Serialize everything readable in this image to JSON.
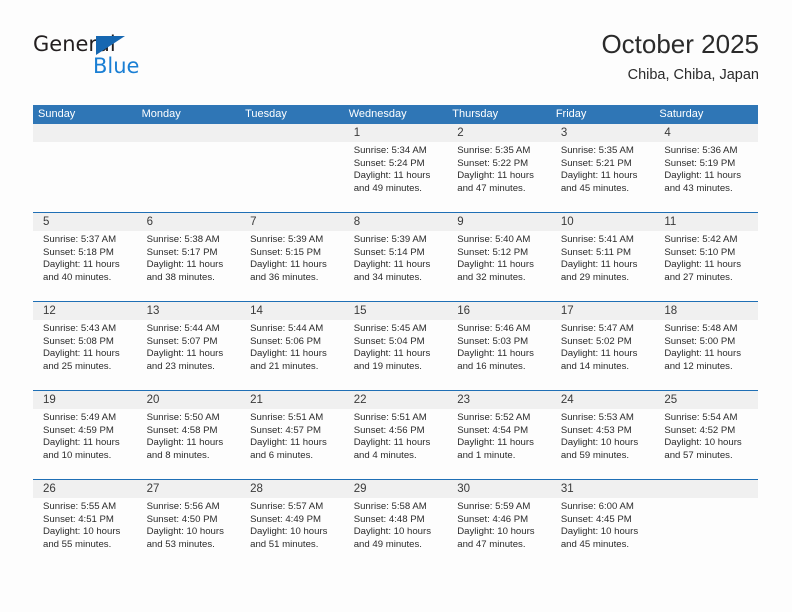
{
  "logo": {
    "word_general": "General",
    "word_blue": "Blue",
    "triangle_color": "#1667b1",
    "blue_text_color": "#1a7fd4"
  },
  "header": {
    "title": "October 2025",
    "subtitle": "Chiba, Chiba, Japan"
  },
  "theme": {
    "header_blue": "#2f76b6",
    "week_separator_blue": "#1f6fb5",
    "day_band_gray": "#f0f0f0",
    "page_background": "#fdfdfd"
  },
  "calendar": {
    "weekday_headers": [
      "Sunday",
      "Monday",
      "Tuesday",
      "Wednesday",
      "Thursday",
      "Friday",
      "Saturday"
    ],
    "weeks": [
      [
        {
          "day": "",
          "sunrise": "",
          "sunset": "",
          "daylight_line1": "",
          "daylight_line2": ""
        },
        {
          "day": "",
          "sunrise": "",
          "sunset": "",
          "daylight_line1": "",
          "daylight_line2": ""
        },
        {
          "day": "",
          "sunrise": "",
          "sunset": "",
          "daylight_line1": "",
          "daylight_line2": ""
        },
        {
          "day": "1",
          "sunrise": "Sunrise: 5:34 AM",
          "sunset": "Sunset: 5:24 PM",
          "daylight_line1": "Daylight: 11 hours",
          "daylight_line2": "and 49 minutes."
        },
        {
          "day": "2",
          "sunrise": "Sunrise: 5:35 AM",
          "sunset": "Sunset: 5:22 PM",
          "daylight_line1": "Daylight: 11 hours",
          "daylight_line2": "and 47 minutes."
        },
        {
          "day": "3",
          "sunrise": "Sunrise: 5:35 AM",
          "sunset": "Sunset: 5:21 PM",
          "daylight_line1": "Daylight: 11 hours",
          "daylight_line2": "and 45 minutes."
        },
        {
          "day": "4",
          "sunrise": "Sunrise: 5:36 AM",
          "sunset": "Sunset: 5:19 PM",
          "daylight_line1": "Daylight: 11 hours",
          "daylight_line2": "and 43 minutes."
        }
      ],
      [
        {
          "day": "5",
          "sunrise": "Sunrise: 5:37 AM",
          "sunset": "Sunset: 5:18 PM",
          "daylight_line1": "Daylight: 11 hours",
          "daylight_line2": "and 40 minutes."
        },
        {
          "day": "6",
          "sunrise": "Sunrise: 5:38 AM",
          "sunset": "Sunset: 5:17 PM",
          "daylight_line1": "Daylight: 11 hours",
          "daylight_line2": "and 38 minutes."
        },
        {
          "day": "7",
          "sunrise": "Sunrise: 5:39 AM",
          "sunset": "Sunset: 5:15 PM",
          "daylight_line1": "Daylight: 11 hours",
          "daylight_line2": "and 36 minutes."
        },
        {
          "day": "8",
          "sunrise": "Sunrise: 5:39 AM",
          "sunset": "Sunset: 5:14 PM",
          "daylight_line1": "Daylight: 11 hours",
          "daylight_line2": "and 34 minutes."
        },
        {
          "day": "9",
          "sunrise": "Sunrise: 5:40 AM",
          "sunset": "Sunset: 5:12 PM",
          "daylight_line1": "Daylight: 11 hours",
          "daylight_line2": "and 32 minutes."
        },
        {
          "day": "10",
          "sunrise": "Sunrise: 5:41 AM",
          "sunset": "Sunset: 5:11 PM",
          "daylight_line1": "Daylight: 11 hours",
          "daylight_line2": "and 29 minutes."
        },
        {
          "day": "11",
          "sunrise": "Sunrise: 5:42 AM",
          "sunset": "Sunset: 5:10 PM",
          "daylight_line1": "Daylight: 11 hours",
          "daylight_line2": "and 27 minutes."
        }
      ],
      [
        {
          "day": "12",
          "sunrise": "Sunrise: 5:43 AM",
          "sunset": "Sunset: 5:08 PM",
          "daylight_line1": "Daylight: 11 hours",
          "daylight_line2": "and 25 minutes."
        },
        {
          "day": "13",
          "sunrise": "Sunrise: 5:44 AM",
          "sunset": "Sunset: 5:07 PM",
          "daylight_line1": "Daylight: 11 hours",
          "daylight_line2": "and 23 minutes."
        },
        {
          "day": "14",
          "sunrise": "Sunrise: 5:44 AM",
          "sunset": "Sunset: 5:06 PM",
          "daylight_line1": "Daylight: 11 hours",
          "daylight_line2": "and 21 minutes."
        },
        {
          "day": "15",
          "sunrise": "Sunrise: 5:45 AM",
          "sunset": "Sunset: 5:04 PM",
          "daylight_line1": "Daylight: 11 hours",
          "daylight_line2": "and 19 minutes."
        },
        {
          "day": "16",
          "sunrise": "Sunrise: 5:46 AM",
          "sunset": "Sunset: 5:03 PM",
          "daylight_line1": "Daylight: 11 hours",
          "daylight_line2": "and 16 minutes."
        },
        {
          "day": "17",
          "sunrise": "Sunrise: 5:47 AM",
          "sunset": "Sunset: 5:02 PM",
          "daylight_line1": "Daylight: 11 hours",
          "daylight_line2": "and 14 minutes."
        },
        {
          "day": "18",
          "sunrise": "Sunrise: 5:48 AM",
          "sunset": "Sunset: 5:00 PM",
          "daylight_line1": "Daylight: 11 hours",
          "daylight_line2": "and 12 minutes."
        }
      ],
      [
        {
          "day": "19",
          "sunrise": "Sunrise: 5:49 AM",
          "sunset": "Sunset: 4:59 PM",
          "daylight_line1": "Daylight: 11 hours",
          "daylight_line2": "and 10 minutes."
        },
        {
          "day": "20",
          "sunrise": "Sunrise: 5:50 AM",
          "sunset": "Sunset: 4:58 PM",
          "daylight_line1": "Daylight: 11 hours",
          "daylight_line2": "and 8 minutes."
        },
        {
          "day": "21",
          "sunrise": "Sunrise: 5:51 AM",
          "sunset": "Sunset: 4:57 PM",
          "daylight_line1": "Daylight: 11 hours",
          "daylight_line2": "and 6 minutes."
        },
        {
          "day": "22",
          "sunrise": "Sunrise: 5:51 AM",
          "sunset": "Sunset: 4:56 PM",
          "daylight_line1": "Daylight: 11 hours",
          "daylight_line2": "and 4 minutes."
        },
        {
          "day": "23",
          "sunrise": "Sunrise: 5:52 AM",
          "sunset": "Sunset: 4:54 PM",
          "daylight_line1": "Daylight: 11 hours",
          "daylight_line2": "and 1 minute."
        },
        {
          "day": "24",
          "sunrise": "Sunrise: 5:53 AM",
          "sunset": "Sunset: 4:53 PM",
          "daylight_line1": "Daylight: 10 hours",
          "daylight_line2": "and 59 minutes."
        },
        {
          "day": "25",
          "sunrise": "Sunrise: 5:54 AM",
          "sunset": "Sunset: 4:52 PM",
          "daylight_line1": "Daylight: 10 hours",
          "daylight_line2": "and 57 minutes."
        }
      ],
      [
        {
          "day": "26",
          "sunrise": "Sunrise: 5:55 AM",
          "sunset": "Sunset: 4:51 PM",
          "daylight_line1": "Daylight: 10 hours",
          "daylight_line2": "and 55 minutes."
        },
        {
          "day": "27",
          "sunrise": "Sunrise: 5:56 AM",
          "sunset": "Sunset: 4:50 PM",
          "daylight_line1": "Daylight: 10 hours",
          "daylight_line2": "and 53 minutes."
        },
        {
          "day": "28",
          "sunrise": "Sunrise: 5:57 AM",
          "sunset": "Sunset: 4:49 PM",
          "daylight_line1": "Daylight: 10 hours",
          "daylight_line2": "and 51 minutes."
        },
        {
          "day": "29",
          "sunrise": "Sunrise: 5:58 AM",
          "sunset": "Sunset: 4:48 PM",
          "daylight_line1": "Daylight: 10 hours",
          "daylight_line2": "and 49 minutes."
        },
        {
          "day": "30",
          "sunrise": "Sunrise: 5:59 AM",
          "sunset": "Sunset: 4:46 PM",
          "daylight_line1": "Daylight: 10 hours",
          "daylight_line2": "and 47 minutes."
        },
        {
          "day": "31",
          "sunrise": "Sunrise: 6:00 AM",
          "sunset": "Sunset: 4:45 PM",
          "daylight_line1": "Daylight: 10 hours",
          "daylight_line2": "and 45 minutes."
        },
        {
          "day": "",
          "sunrise": "",
          "sunset": "",
          "daylight_line1": "",
          "daylight_line2": ""
        }
      ]
    ]
  }
}
